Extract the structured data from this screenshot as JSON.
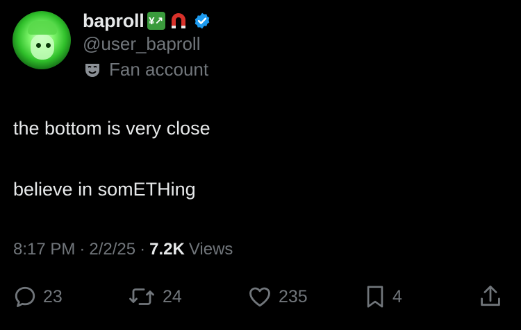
{
  "author": {
    "display_name": "baproll",
    "emoji_badge": "💹",
    "handle": "@user_baproll",
    "label": "Fan account",
    "verified": true,
    "verified_color": "#1d9bf0"
  },
  "tweet": {
    "lines": [
      "the bottom is very close",
      "believe in somETHing"
    ]
  },
  "meta": {
    "time": "8:17 PM",
    "date": "2/2/25",
    "views_count": "7.2K",
    "views_label": "Views",
    "separator": "·"
  },
  "actions": {
    "replies": "23",
    "reposts": "24",
    "likes": "235",
    "bookmarks": "4"
  },
  "icons": [
    "avatar",
    "chart-emoji-icon",
    "magnet-emoji-icon",
    "verified-badge-icon",
    "theater-mask-icon",
    "reply-icon",
    "repost-icon",
    "like-icon",
    "bookmark-icon",
    "share-icon"
  ],
  "colors": {
    "background": "#000000",
    "primary_text": "#e7e9ea",
    "secondary_text": "#71767b"
  }
}
